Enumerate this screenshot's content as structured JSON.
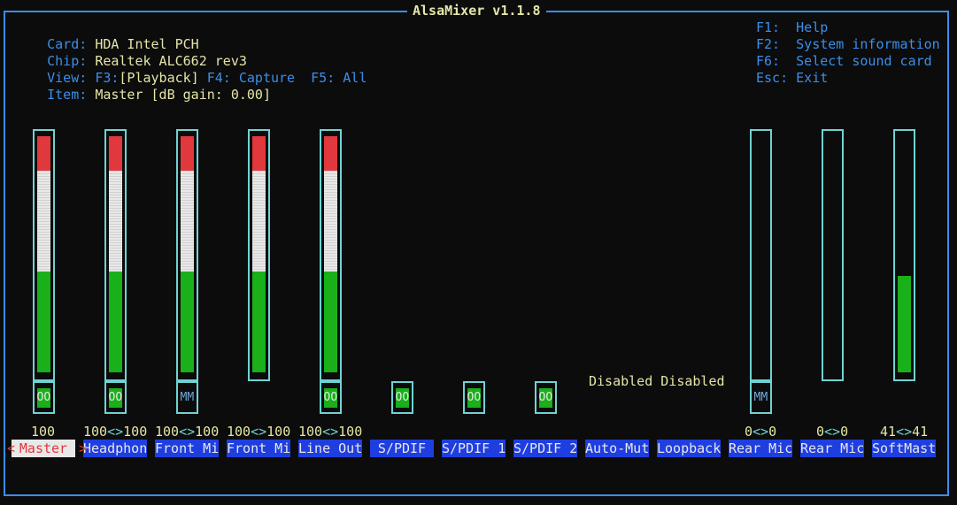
{
  "title": "AlsaMixer v1.1.8",
  "info": {
    "card_label": "Card:",
    "card_value": "HDA Intel PCH",
    "chip_label": "Chip:",
    "chip_value": "Realtek ALC662 rev3",
    "view_label": "View:",
    "view_f3": "F3:",
    "view_playback": "[Playback]",
    "view_f4": "F4: Capture",
    "view_f5": "F5: All",
    "item_label": "Item:",
    "item_value": "Master [dB gain: 0.00]"
  },
  "help": {
    "f1_key": "F1:",
    "f1_text": "Help",
    "f2_key": "F2:",
    "f2_text": "System information",
    "f6_key": "F6:",
    "f6_text": "Select sound card",
    "esc_key": "Esc:",
    "esc_text": "Exit"
  },
  "disabled_text": "Disabled Disabled",
  "selected_left_arrow": "<",
  "selected_right_arrow": ">",
  "controls": [
    {
      "name": "Master",
      "value_left": "100",
      "value_sep": "",
      "value_right": "",
      "level_percent": 100,
      "switch": "OO"
    },
    {
      "name": "Headphon",
      "value_left": "100",
      "value_sep": "<>",
      "value_right": "100",
      "level_percent": 100,
      "switch": "OO"
    },
    {
      "name": "Front Mi",
      "value_left": "100",
      "value_sep": "<>",
      "value_right": "100",
      "level_percent": 100,
      "switch": "MM"
    },
    {
      "name": "Front Mi",
      "value_left": "100",
      "value_sep": "<>",
      "value_right": "100",
      "level_percent": 100,
      "switch": ""
    },
    {
      "name": "Line Out",
      "value_left": "100",
      "value_sep": "<>",
      "value_right": "100",
      "level_percent": 100,
      "switch": "OO"
    },
    {
      "name": "S/PDIF",
      "value_left": "",
      "value_sep": "",
      "value_right": "",
      "switch": "OO"
    },
    {
      "name": "S/PDIF 1",
      "value_left": "",
      "value_sep": "",
      "value_right": "",
      "switch": "OO"
    },
    {
      "name": "S/PDIF 2",
      "value_left": "",
      "value_sep": "",
      "value_right": "",
      "switch": "OO"
    },
    {
      "name": "Auto-Mut",
      "value_left": "",
      "value_sep": "",
      "value_right": ""
    },
    {
      "name": "Loopback",
      "value_left": "",
      "value_sep": "",
      "value_right": ""
    },
    {
      "name": "Rear Mic",
      "value_left": "0",
      "value_sep": "<>",
      "value_right": "0",
      "level_percent": 0,
      "switch": "MM"
    },
    {
      "name": "Rear Mic",
      "value_left": "0",
      "value_sep": "<>",
      "value_right": "0",
      "level_percent": 0,
      "switch": ""
    },
    {
      "name": "SoftMast",
      "value_left": "41",
      "value_sep": "<>",
      "value_right": "41",
      "level_percent": 41,
      "switch": ""
    }
  ],
  "colors": {
    "border": "#3b8eea",
    "bar_border": "#6fd3d3",
    "level_high": "#e0383d",
    "level_mid": "#e8e8e8",
    "level_low": "#19b019",
    "name_bg": "#1f3ee0"
  }
}
